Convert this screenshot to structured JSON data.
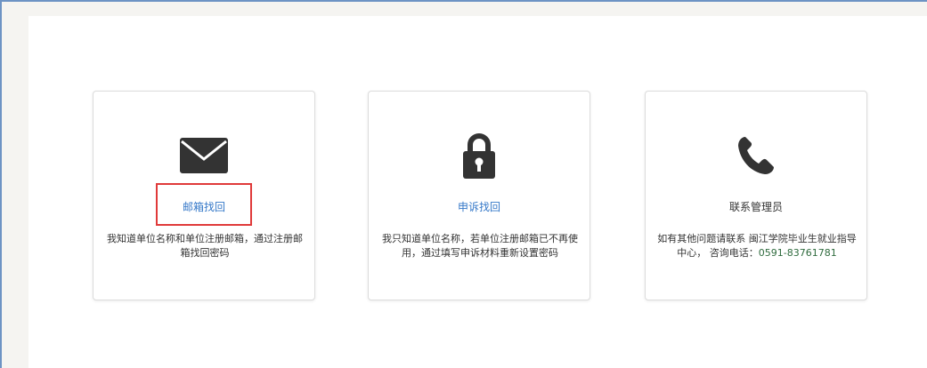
{
  "cards": [
    {
      "icon": "envelope-icon",
      "title": "邮箱找回",
      "description": "我知道单位名称和单位注册邮箱，通过注册邮箱找回密码"
    },
    {
      "icon": "lock-icon",
      "title": "申诉找回",
      "description": "我只知道单位名称，若单位注册邮箱已不再使用，通过填写申诉材料重新设置密码"
    },
    {
      "icon": "phone-icon",
      "title": "联系管理员",
      "description_prefix": "如有其他问题请联系 闽江学院毕业生就业指导中心， 咨询电话：",
      "phone": "0591-83761781"
    }
  ],
  "colors": {
    "link_blue": "#3578c8",
    "highlight_red": "#e03a3a",
    "phone_green": "#2f6b3e",
    "icon_dark": "#333333"
  }
}
